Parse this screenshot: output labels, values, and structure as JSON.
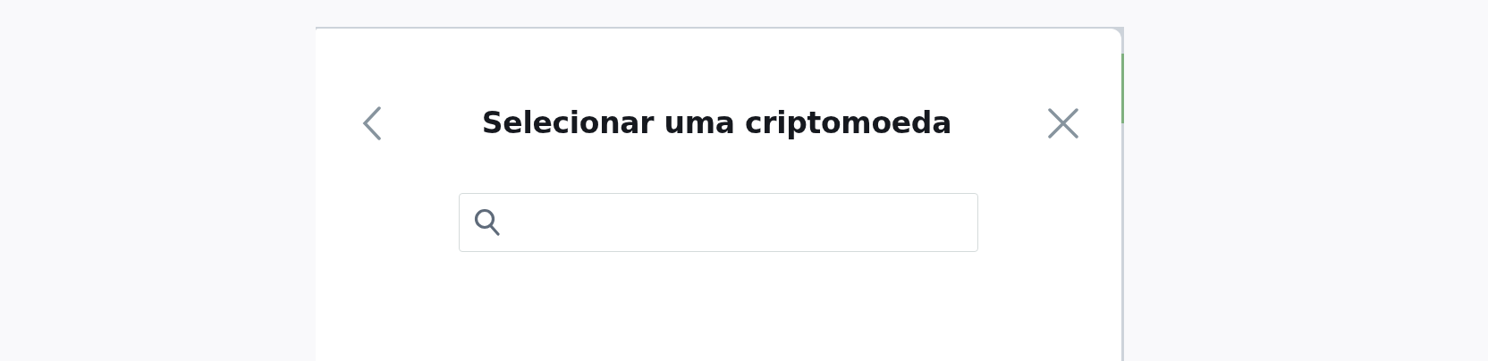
{
  "dialog": {
    "title": "Selecionar uma criptomoeda"
  }
}
